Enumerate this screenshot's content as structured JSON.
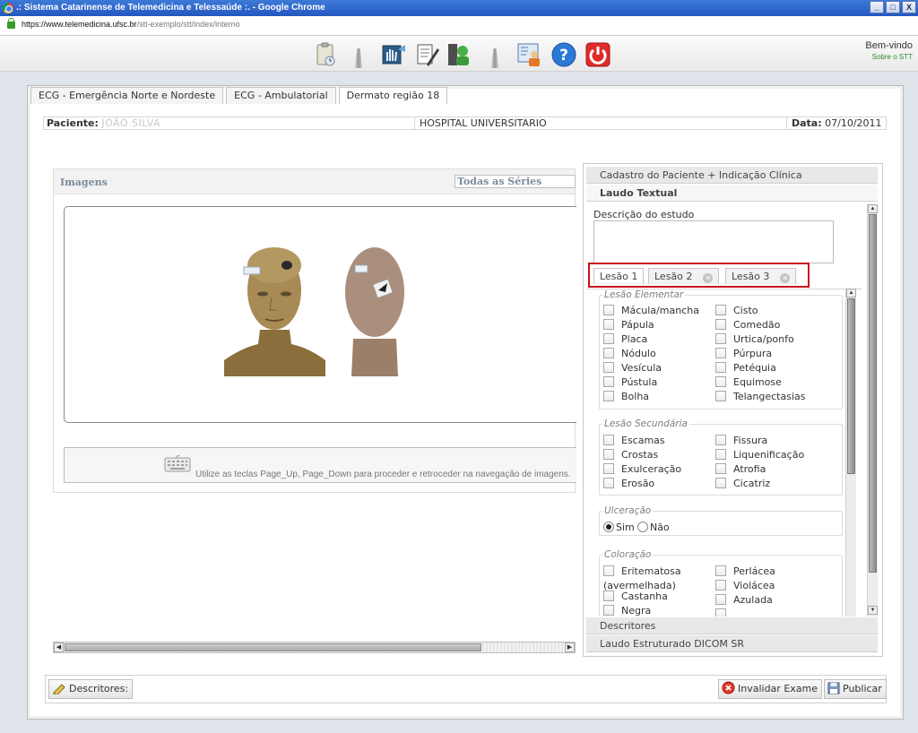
{
  "window": {
    "title": ".: Sistema Catarinense de Telemedicina e Telessaúde :. - Google Chrome",
    "controls": [
      "_",
      "□",
      "X"
    ]
  },
  "address": {
    "host": "https://www.telemedicina.ufsc.br",
    "path": "/stt-exemplo/stt/index/interno"
  },
  "toolbar": {
    "welcome": "Bem-vindo",
    "about": "Sobre o STT"
  },
  "tabs": [
    "ECG - Emergência Norte e Nordeste",
    "ECG - Ambulatorial",
    "Dermato região 18"
  ],
  "patient": {
    "label": "Paciente:",
    "name": "JOÃO SILVA",
    "hospital": "HOSPITAL UNIVERSITARIO",
    "date_label": "Data:",
    "date": "07/10/2011"
  },
  "images": {
    "title": "Imagens",
    "series": "Todas as Séries",
    "hint": "Utilize as teclas Page_Up, Page_Down para proceder e retroceder na navegação de imagens."
  },
  "accordion": {
    "cadastro": "Cadastro do Paciente + Indicação Clínica",
    "laudo": "Laudo Textual",
    "descritores": "Descritores",
    "dicom": "Laudo Estruturado DICOM SR"
  },
  "laudo": {
    "desc_label": "Descrição do estudo",
    "lesion_tabs": [
      "Lesão 1",
      "Lesão 2",
      "Lesão 3"
    ],
    "elementar": {
      "legend": "Lesão Elementar",
      "left": [
        "Mácula/mancha",
        "Pápula",
        "Placa",
        "Nódulo",
        "Vesícula",
        "Pústula",
        "Bolha"
      ],
      "right": [
        "Cisto",
        "Comedão",
        "Urtica/ponfo",
        "Púrpura",
        "Petéquia",
        "Equimose",
        "Telangectasias"
      ]
    },
    "secundaria": {
      "legend": "Lesão Secundária",
      "left": [
        "Escamas",
        "Crostas",
        "Exulceração",
        "Erosão"
      ],
      "right": [
        "Fissura",
        "Liquenificação",
        "Atrofia",
        "Cicatriz"
      ]
    },
    "ulceracao": {
      "legend": "Ulceração",
      "sim": "Sim",
      "nao": "Não",
      "selected": "Sim"
    },
    "coloracao": {
      "legend": "Coloração",
      "left": [
        "Eritematosa",
        "(avermelhada)",
        "Castanha",
        "Negra"
      ],
      "right": [
        "Perlácea",
        "Violácea",
        "Azulada"
      ]
    }
  },
  "bottom": {
    "descritores": "Descritores:",
    "invalidar": "Invalidar Exame",
    "publicar": "Publicar"
  },
  "colors": {
    "title_bar": "#2f66cc",
    "highlight": "#c8141e",
    "welcome_link": "#2a8a2a"
  }
}
